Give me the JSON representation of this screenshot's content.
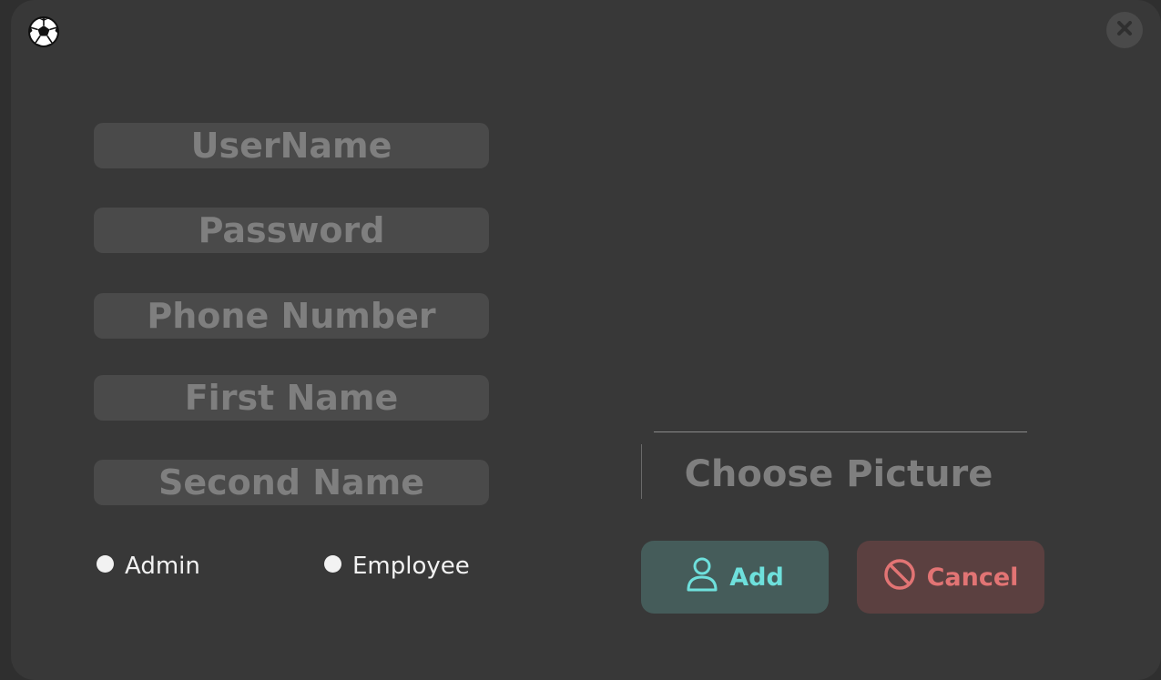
{
  "window": {
    "app_icon": "soccer-ball-icon",
    "close_icon": "close-icon"
  },
  "form": {
    "username": {
      "placeholder": "UserName",
      "value": ""
    },
    "password": {
      "placeholder": "Password",
      "value": ""
    },
    "phone": {
      "placeholder": "Phone Number",
      "value": ""
    },
    "first_name": {
      "placeholder": "First Name",
      "value": ""
    },
    "second_name": {
      "placeholder": "Second Name",
      "value": ""
    }
  },
  "roles": {
    "admin_label": "Admin",
    "employee_label": "Employee",
    "selected": ""
  },
  "picture": {
    "choose_label": "Choose Picture"
  },
  "actions": {
    "add_label": "Add",
    "add_icon": "user-icon",
    "cancel_label": "Cancel",
    "cancel_icon": "prohibited-icon"
  },
  "colors": {
    "background": "#383838",
    "field": "#4a4a4a",
    "placeholder": "#7f7f7f",
    "add_bg": "#455c5a",
    "add_fg": "#6ee0dc",
    "cancel_bg": "#5b4040",
    "cancel_fg": "#e27474"
  }
}
